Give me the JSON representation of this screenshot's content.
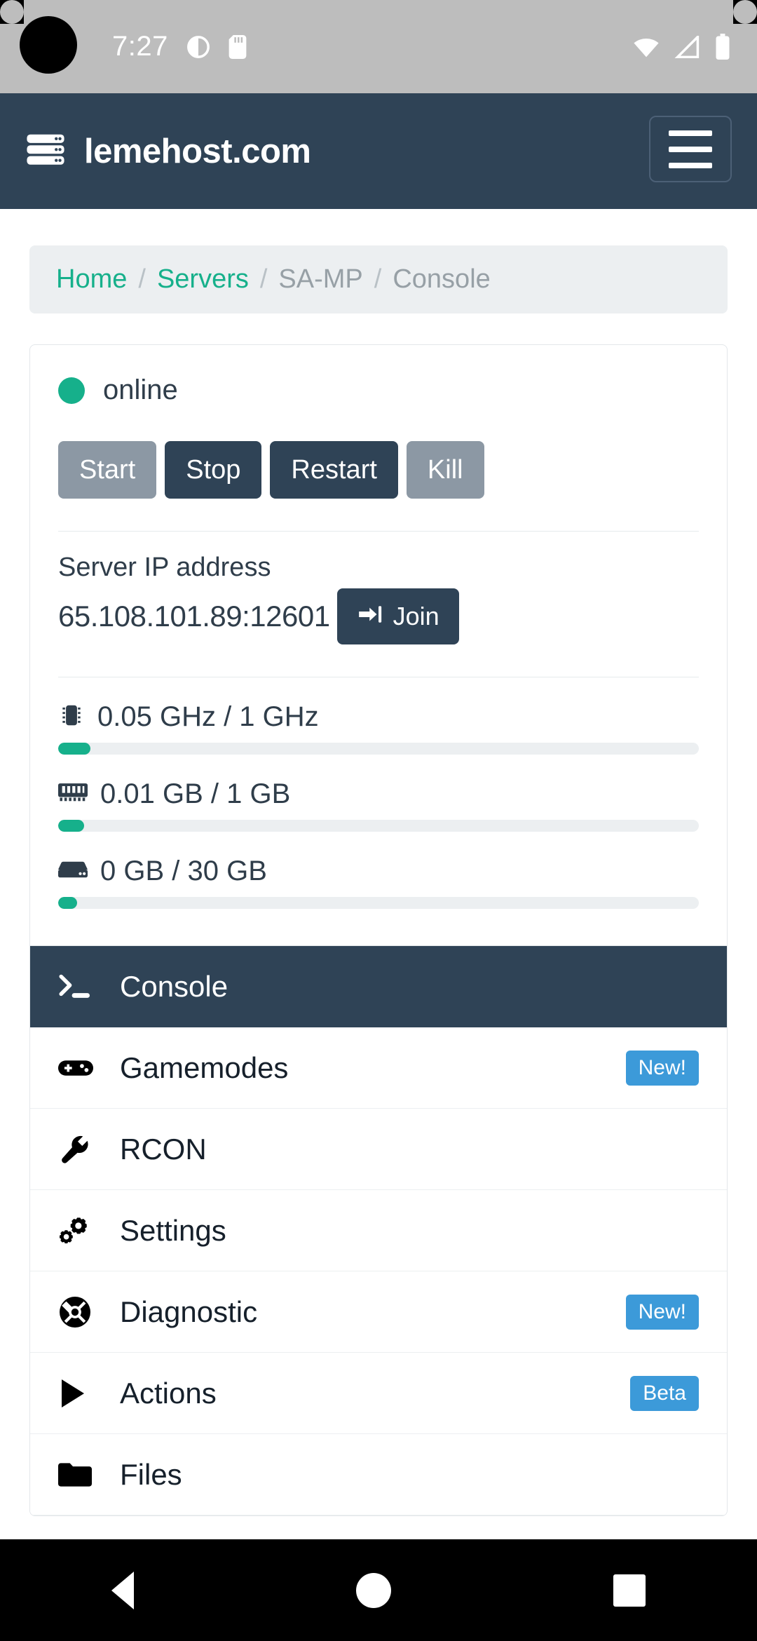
{
  "statusbar": {
    "time": "7:27",
    "icons": [
      "dnd-icon",
      "sd-card-icon",
      "wifi-icon",
      "signal-icon",
      "battery-icon"
    ]
  },
  "navbar": {
    "brand": "lemehost.com",
    "logo_icon": "server-rack-icon",
    "menu_icon": "hamburger-menu-icon"
  },
  "breadcrumb": {
    "items": [
      {
        "label": "Home",
        "type": "link"
      },
      {
        "label": "Servers",
        "type": "link"
      },
      {
        "label": "SA-MP",
        "type": "plain"
      },
      {
        "label": "Console",
        "type": "plain"
      }
    ],
    "separator": "/"
  },
  "server": {
    "status": "online",
    "status_color": "#16b08b",
    "controls": [
      {
        "label": "Start",
        "style": "muted"
      },
      {
        "label": "Stop",
        "style": "dark"
      },
      {
        "label": "Restart",
        "style": "dark"
      },
      {
        "label": "Kill",
        "style": "muted"
      }
    ],
    "ip_label": "Server IP address",
    "ip_value": "65.108.101.89:12601",
    "join_label": "Join",
    "join_icon": "sign-in-icon",
    "meters": [
      {
        "icon": "cpu-icon",
        "text": "0.05 GHz / 1 GHz",
        "percent": 5
      },
      {
        "icon": "ram-icon",
        "text": "0.01 GB / 1 GB",
        "percent": 4
      },
      {
        "icon": "disk-icon",
        "text": "0 GB / 30 GB",
        "percent": 3
      }
    ]
  },
  "navlist": [
    {
      "label": "Console",
      "icon": "terminal-icon",
      "active": true,
      "badge": ""
    },
    {
      "label": "Gamemodes",
      "icon": "gamepad-icon",
      "active": false,
      "badge": "New!"
    },
    {
      "label": "RCON",
      "icon": "wrench-icon",
      "active": false,
      "badge": ""
    },
    {
      "label": "Settings",
      "icon": "gears-icon",
      "active": false,
      "badge": ""
    },
    {
      "label": "Diagnostic",
      "icon": "lifebuoy-icon",
      "active": false,
      "badge": "New!"
    },
    {
      "label": "Actions",
      "icon": "play-icon",
      "active": false,
      "badge": "Beta"
    },
    {
      "label": "Files",
      "icon": "folder-icon",
      "active": false,
      "badge": ""
    }
  ],
  "colors": {
    "navy": "#2f4356",
    "teal": "#16b08b",
    "badge_blue": "#3c9ad9",
    "muted": "#8c98a4"
  },
  "androidnav": {
    "back": "back-triangle-icon",
    "home": "home-circle-icon",
    "recent": "recent-square-icon"
  }
}
